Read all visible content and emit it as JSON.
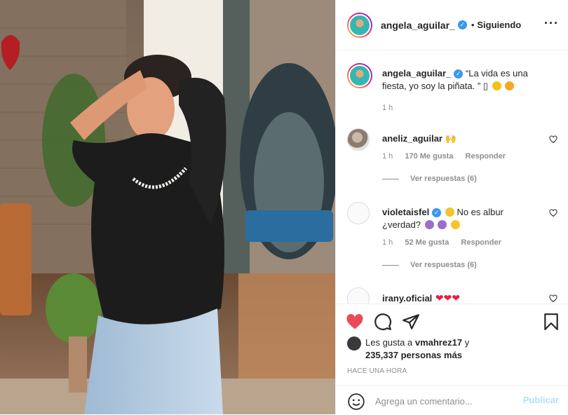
{
  "post": {
    "author": "angela_aguilar_",
    "separator": "•",
    "follow_status": "Siguiendo",
    "more_icon": "more-options-icon",
    "caption": {
      "username": "angela_aguilar_",
      "text": "“La vida es una fiesta, yo soy la piñata. ” ",
      "placeholder_glyph": "▯",
      "time": "1 h"
    },
    "comments": [
      {
        "username": "aneliz_aguilar",
        "text": "",
        "emoji": "🙌",
        "time": "1 h",
        "likes": "170 Me gusta",
        "reply": "Responder",
        "view_replies": "Ver respuestas (6)"
      },
      {
        "username": "violetaisfel",
        "text": "No es albur ¿verdad?",
        "time": "1 h",
        "likes": "52 Me gusta",
        "reply": "Responder",
        "view_replies": "Ver respuestas (6)"
      },
      {
        "username": "irany.oficial",
        "text": "",
        "emoji": "❤❤❤"
      }
    ],
    "likes": {
      "prefix": "Les gusta a",
      "first_user": "vmahrez17",
      "connector": "y",
      "others": "235,337 personas más"
    },
    "time_ago": "HACE UNA HORA",
    "comment_input": {
      "placeholder": "Agrega un comentario...",
      "value": ""
    },
    "publish_label": "Publicar"
  },
  "colors": {
    "like_red": "#ed4956",
    "verified_blue": "#3897f0",
    "publish_disabled": "#b2dffc",
    "muted_text": "#8e8e8e"
  }
}
